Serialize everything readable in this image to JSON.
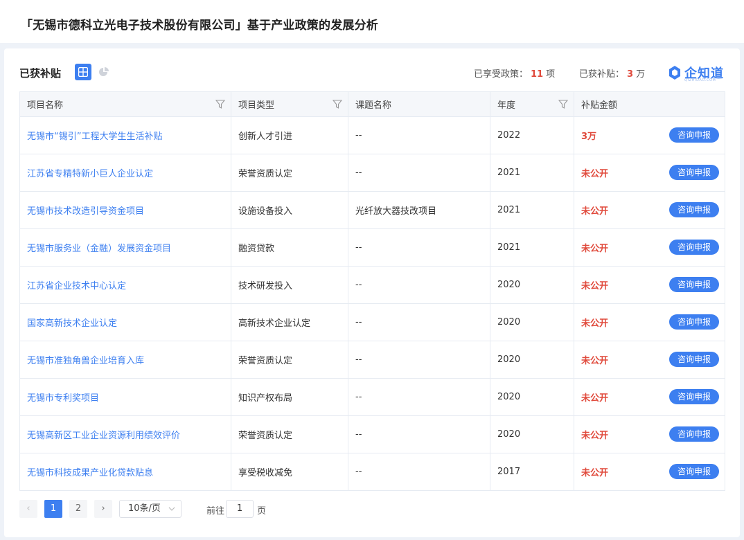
{
  "page": {
    "title": "「无锡市德科立光电子技术股份有限公司」基于产业政策的发展分析"
  },
  "card": {
    "title": "已获补贴",
    "stats": {
      "policy_label": "已享受政策：",
      "policy_count": "11",
      "policy_unit": "项",
      "subsidy_label": "已获补贴：",
      "subsidy_amount": "3",
      "subsidy_unit": "万"
    },
    "brand": {
      "name": "企知道",
      "subtitle": "QIZHIDAO.COM"
    }
  },
  "table": {
    "columns": [
      "项目名称",
      "项目类型",
      "课题名称",
      "年度",
      "补贴金额"
    ],
    "action_label": "咨询申报",
    "rows": [
      {
        "name": "无锡市“锡引”工程大学生生活补贴",
        "type": "创新人才引进",
        "topic": "--",
        "year": "2022",
        "amount": "3万"
      },
      {
        "name": "江苏省专精特新小巨人企业认定",
        "type": "荣誉资质认定",
        "topic": "--",
        "year": "2021",
        "amount": "未公开"
      },
      {
        "name": "无锡市技术改造引导资金项目",
        "type": "设施设备投入",
        "topic": "光纤放大器技改项目",
        "year": "2021",
        "amount": "未公开"
      },
      {
        "name": "无锡市服务业（金融）发展资金项目",
        "type": "融资贷款",
        "topic": "--",
        "year": "2021",
        "amount": "未公开"
      },
      {
        "name": "江苏省企业技术中心认定",
        "type": "技术研发投入",
        "topic": "--",
        "year": "2020",
        "amount": "未公开"
      },
      {
        "name": "国家高新技术企业认定",
        "type": "高新技术企业认定",
        "topic": "--",
        "year": "2020",
        "amount": "未公开"
      },
      {
        "name": "无锡市准独角兽企业培育入库",
        "type": "荣誉资质认定",
        "topic": "--",
        "year": "2020",
        "amount": "未公开"
      },
      {
        "name": "无锡市专利奖项目",
        "type": "知识产权布局",
        "topic": "--",
        "year": "2020",
        "amount": "未公开"
      },
      {
        "name": "无锡高新区工业企业资源利用绩效评价",
        "type": "荣誉资质认定",
        "topic": "--",
        "year": "2020",
        "amount": "未公开"
      },
      {
        "name": "无锡市科技成果产业化贷款贴息",
        "type": "享受税收减免",
        "topic": "--",
        "year": "2017",
        "amount": "未公开"
      }
    ]
  },
  "pagination": {
    "prev": "‹",
    "next": "›",
    "pages": [
      "1",
      "2"
    ],
    "current": "1",
    "page_size": "10条/页",
    "goto_label": "前往",
    "goto_value": "1",
    "goto_suffix": "页"
  },
  "colors": {
    "accent": "#3d7ff0",
    "amount": "#e04a3c"
  }
}
